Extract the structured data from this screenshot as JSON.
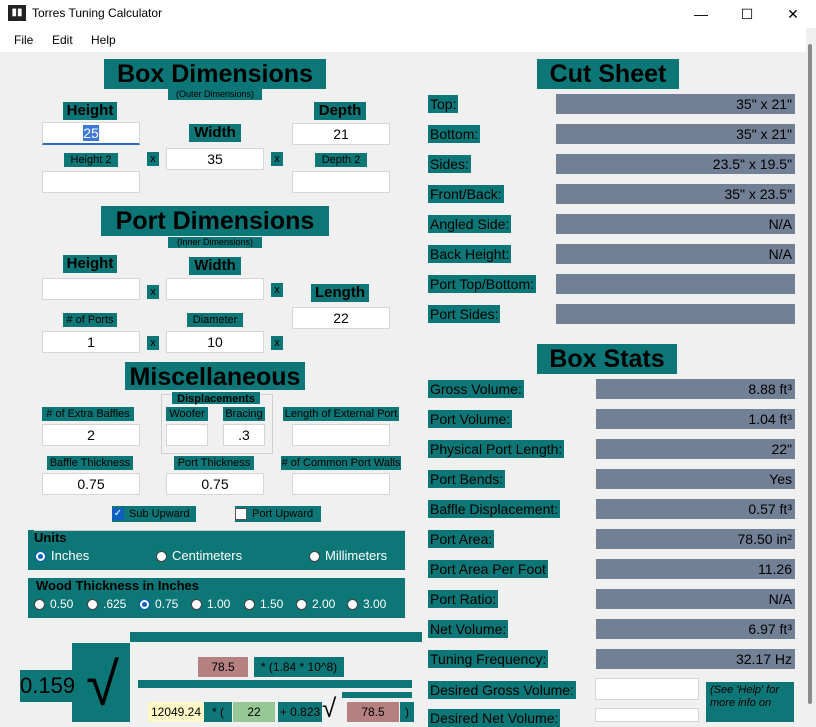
{
  "window": {
    "title": "Torres Tuning Calculator",
    "minimize": "—",
    "maximize": "☐",
    "close": "✕"
  },
  "menu": [
    "File",
    "Edit",
    "Help"
  ],
  "box_dims": {
    "title": "Box Dimensions",
    "subtitle": "(Outer Dimensions)",
    "height_label": "Height",
    "height_value": "25",
    "width_label": "Width",
    "width_value": "35",
    "depth_label": "Depth",
    "depth_value": "21",
    "height2_label": "Height 2",
    "height2_value": "",
    "depth2_label": "Depth 2",
    "depth2_value": "",
    "x": "x"
  },
  "port_dims": {
    "title": "Port Dimensions",
    "subtitle": "(Inner Dimensions)",
    "height_label": "Height",
    "height_value": "",
    "width_label": "Width",
    "width_value": "",
    "length_label": "Length",
    "length_value": "22",
    "ports_label": "# of Ports",
    "ports_value": "1",
    "diameter_label": "Diameter",
    "diameter_value": "10"
  },
  "misc": {
    "title": "Miscellaneous",
    "displacements_label": "Displacements",
    "extra_baffles_label": "# of Extra Baffles",
    "extra_baffles_value": "2",
    "woofer_label": "Woofer",
    "woofer_value": "",
    "bracing_label": "Bracing",
    "bracing_value": ".3",
    "ext_port_label": "Length of External Port",
    "ext_port_value": "",
    "baffle_thick_label": "Baffle Thickness",
    "baffle_thick_value": "0.75",
    "port_thick_label": "Port Thickness",
    "port_thick_value": "0.75",
    "common_walls_label": "# of Common Port Walls",
    "common_walls_value": "",
    "sub_upward": "Sub Upward",
    "port_upward": "Port Upward"
  },
  "units": {
    "label": "Units",
    "options": [
      "Inches",
      "Centimeters",
      "Millimeters"
    ],
    "selected": "Inches"
  },
  "wood": {
    "label": "Wood Thickness in Inches",
    "options": [
      "0.50",
      ".625",
      "0.75",
      "1.00",
      "1.50",
      "2.00",
      "3.00"
    ],
    "selected": "0.75"
  },
  "formula": {
    "coef": "0.159",
    "sqrt": "√",
    "port_area": "78.5",
    "factor": "* (1.84 * 10^8)",
    "volume": "12049.24",
    "times": "* (",
    "length": "22",
    "plus": "+ 0.823",
    "area2": "78.5",
    "close": ")"
  },
  "cut_sheet": {
    "title": "Cut Sheet",
    "rows": [
      {
        "label": "Top:",
        "value": "35\" x 21\""
      },
      {
        "label": "Bottom:",
        "value": "35\" x 21\""
      },
      {
        "label": "Sides:",
        "value": "23.5\" x 19.5\""
      },
      {
        "label": "Front/Back:",
        "value": "35\" x 23.5\""
      },
      {
        "label": "Angled Side:",
        "value": "N/A"
      },
      {
        "label": "Back Height:",
        "value": "N/A"
      },
      {
        "label": "Port Top/Bottom:",
        "value": ""
      },
      {
        "label": "Port Sides:",
        "value": ""
      }
    ]
  },
  "box_stats": {
    "title": "Box Stats",
    "rows": [
      {
        "label": "Gross Volume:",
        "value": "8.88 ft³"
      },
      {
        "label": "Port Volume:",
        "value": "1.04 ft³"
      },
      {
        "label": "Physical Port Length:",
        "value": "22\""
      },
      {
        "label": "Port Bends:",
        "value": "Yes"
      },
      {
        "label": "Baffle Displacement:",
        "value": "0.57 ft³"
      },
      {
        "label": "Port Area:",
        "value": "78.50 in²"
      },
      {
        "label": "Port Area Per Foot",
        "value": "11.26"
      },
      {
        "label": "Port Ratio:",
        "value": "N/A"
      },
      {
        "label": "Net Volume:",
        "value": "6.97 ft³"
      },
      {
        "label": "Tuning Frequency:",
        "value": "32.17 Hz"
      }
    ],
    "desired_gross_label": "Desired Gross Volume:",
    "desired_net_label": "Desired Net Volume:",
    "help_note": "(See 'Help' for more info on"
  }
}
